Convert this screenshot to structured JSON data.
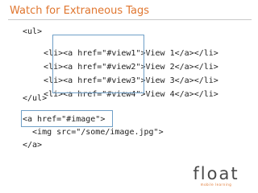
{
  "slide": {
    "title": "Watch for Extraneous Tags"
  },
  "code_block_1": {
    "lines": [
      {
        "indent": "",
        "text": "<ul>"
      },
      {
        "indent": "  ",
        "prefix": "<li>",
        "anchor": "<a href=\"#view1\">",
        "suffix": "View 1</a></li>"
      },
      {
        "indent": "  ",
        "prefix": "<li>",
        "anchor": "<a href=\"#view2\">",
        "suffix": "View 2</a></li>"
      },
      {
        "indent": "  ",
        "prefix": "<li>",
        "anchor": "<a href=\"#view3\">",
        "suffix": "View 3</a></li>"
      },
      {
        "indent": "  ",
        "prefix": "<li>",
        "anchor": "<a href=\"#view4\">",
        "suffix": "View 4</a></li>"
      },
      {
        "indent": "",
        "text": "</ul>"
      }
    ]
  },
  "code_block_2": {
    "lines": [
      {
        "text": "<a href=\"#image\">"
      },
      {
        "text": "  <img src=\"/some/image.jpg\">"
      },
      {
        "text": "</a>"
      }
    ]
  },
  "logo": {
    "word": "float",
    "tagline": "mobile learning"
  },
  "colors": {
    "accent": "#e0762f",
    "highlight_border": "#6f9fc7"
  }
}
